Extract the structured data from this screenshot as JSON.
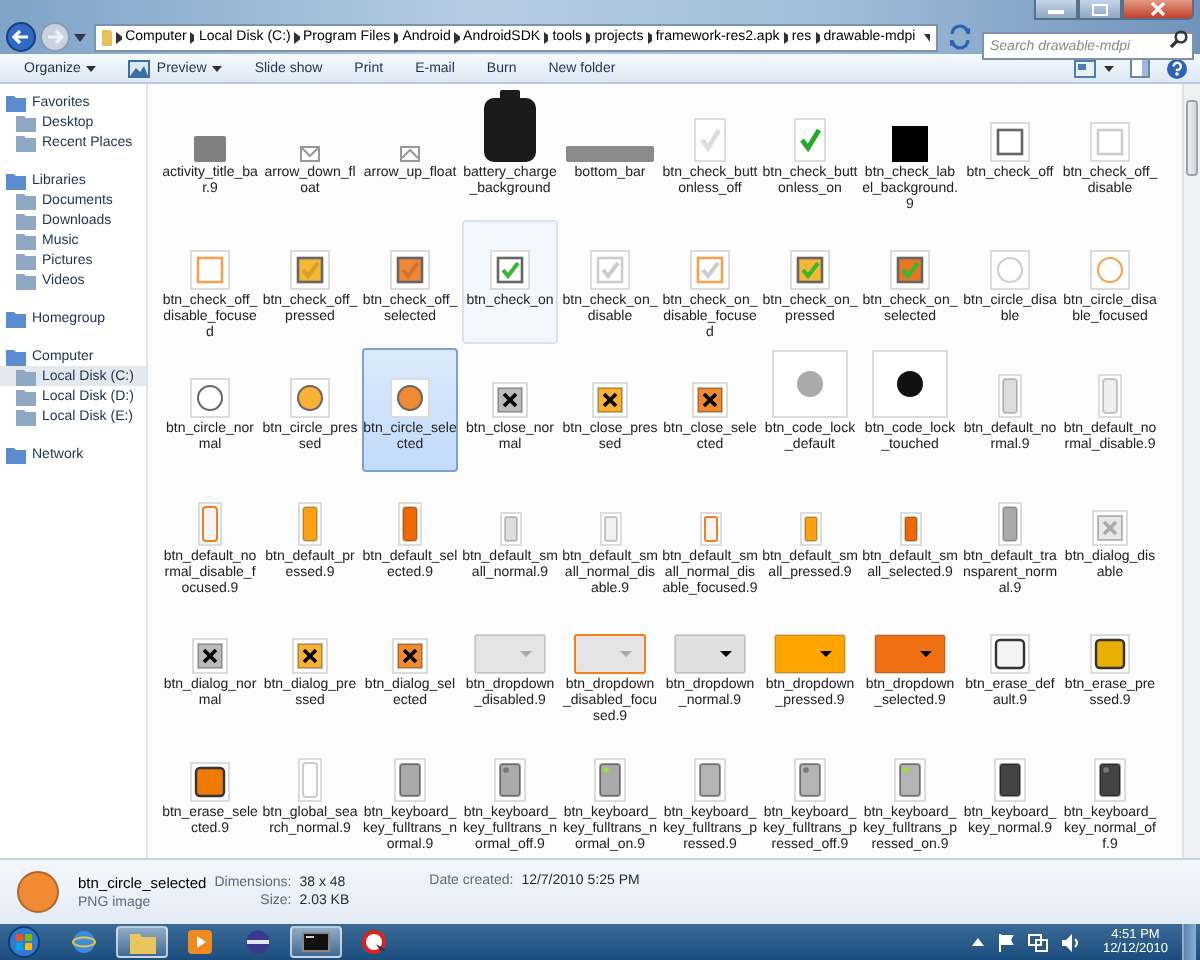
{
  "address": {
    "segments": [
      "Computer",
      "Local Disk (C:)",
      "Program Files",
      "Android",
      "AndroidSDK",
      "tools",
      "projects",
      "framework-res2.apk",
      "res",
      "drawable-mdpi"
    ]
  },
  "search": {
    "placeholder": "Search drawable-mdpi"
  },
  "toolbar": [
    {
      "label": "Organize",
      "dropdown": true
    },
    {
      "label": "Preview",
      "dropdown": true
    },
    {
      "label": "Slide show",
      "dropdown": false
    },
    {
      "label": "Print",
      "dropdown": false
    },
    {
      "label": "E-mail",
      "dropdown": false
    },
    {
      "label": "Burn",
      "dropdown": false
    },
    {
      "label": "New folder",
      "dropdown": false
    }
  ],
  "sidebar": [
    {
      "label": "Favorites",
      "selected": false,
      "children": [
        {
          "label": "Desktop",
          "selected": false
        },
        {
          "label": "Recent Places",
          "selected": false
        }
      ]
    },
    {
      "label": "Libraries",
      "selected": false,
      "children": [
        {
          "label": "Documents",
          "selected": false
        },
        {
          "label": "Downloads",
          "selected": false
        },
        {
          "label": "Music",
          "selected": false
        },
        {
          "label": "Pictures",
          "selected": false
        },
        {
          "label": "Videos",
          "selected": false
        }
      ]
    },
    {
      "label": "Homegroup",
      "selected": false
    },
    {
      "label": "Computer",
      "selected": false,
      "children": [
        {
          "label": "Local Disk (C:)",
          "selected": true
        },
        {
          "label": "Local Disk (D:)",
          "selected": false
        },
        {
          "label": "Local Disk (E:)",
          "selected": false
        }
      ]
    },
    {
      "label": "Network",
      "selected": false
    }
  ],
  "files": [
    {
      "name": "activity_title_bar.9",
      "selected": false,
      "hovered": false,
      "thumb": {
        "kind": "panel",
        "color": "#808080"
      }
    },
    {
      "name": "arrow_down_float",
      "selected": false,
      "hovered": false,
      "thumb": {
        "kind": "arrow-down",
        "color": "#999999"
      }
    },
    {
      "name": "arrow_up_float",
      "selected": false,
      "hovered": false,
      "thumb": {
        "kind": "arrow-up",
        "color": "#999999"
      }
    },
    {
      "name": "battery_charge_background",
      "selected": false,
      "hovered": false,
      "thumb": {
        "kind": "battery",
        "color": "#1a1a1a"
      }
    },
    {
      "name": "bottom_bar",
      "selected": false,
      "hovered": false,
      "thumb": {
        "kind": "strip",
        "color": "#8a8a8a"
      }
    },
    {
      "name": "btn_check_buttonless_off",
      "selected": false,
      "hovered": false,
      "thumb": {
        "kind": "tick",
        "checked": false
      }
    },
    {
      "name": "btn_check_buttonless_on",
      "selected": false,
      "hovered": false,
      "thumb": {
        "kind": "tick",
        "checked": true
      }
    },
    {
      "name": "btn_check_label_background.9",
      "selected": false,
      "hovered": false,
      "thumb": {
        "kind": "square",
        "color": "#000000"
      }
    },
    {
      "name": "btn_check_off",
      "selected": false,
      "hovered": false,
      "thumb": {
        "kind": "checkbox",
        "checked": false,
        "disabled": false,
        "focused": false
      }
    },
    {
      "name": "btn_check_off_disable",
      "selected": false,
      "hovered": false,
      "thumb": {
        "kind": "checkbox",
        "checked": false,
        "disabled": true,
        "focused": false
      }
    },
    {
      "name": "btn_check_off_disable_focused",
      "selected": false,
      "hovered": false,
      "thumb": {
        "kind": "checkbox",
        "checked": false,
        "disabled": true,
        "focused": true
      }
    },
    {
      "name": "btn_check_off_pressed",
      "selected": false,
      "hovered": false,
      "thumb": {
        "kind": "checkbox",
        "color": "#f7b733",
        "checked": false,
        "disabled": false,
        "focused": false
      }
    },
    {
      "name": "btn_check_off_selected",
      "selected": false,
      "hovered": false,
      "thumb": {
        "kind": "checkbox",
        "color": "#ee8833",
        "checked": false,
        "disabled": false,
        "focused": false
      }
    },
    {
      "name": "btn_check_on",
      "selected": false,
      "hovered": true,
      "thumb": {
        "kind": "checkbox",
        "checked": true,
        "disabled": false,
        "focused": false
      }
    },
    {
      "name": "btn_check_on_disable",
      "selected": false,
      "hovered": false,
      "thumb": {
        "kind": "checkbox",
        "checked": true,
        "disabled": true,
        "focused": false
      }
    },
    {
      "name": "btn_check_on_disable_focused",
      "selected": false,
      "hovered": false,
      "thumb": {
        "kind": "checkbox",
        "checked": true,
        "disabled": true,
        "focused": true
      }
    },
    {
      "name": "btn_check_on_pressed",
      "selected": false,
      "hovered": false,
      "thumb": {
        "kind": "checkbox",
        "color": "#f7b733",
        "checked": true,
        "disabled": false,
        "focused": false
      }
    },
    {
      "name": "btn_check_on_selected",
      "selected": false,
      "hovered": false,
      "thumb": {
        "kind": "checkbox",
        "color": "#e87722",
        "checked": true,
        "disabled": false,
        "focused": false
      }
    },
    {
      "name": "btn_circle_disable",
      "selected": false,
      "hovered": false,
      "thumb": {
        "kind": "circle",
        "disabled": true,
        "focused": false
      }
    },
    {
      "name": "btn_circle_disable_focused",
      "selected": false,
      "hovered": false,
      "thumb": {
        "kind": "circle",
        "disabled": true,
        "focused": true
      }
    },
    {
      "name": "btn_circle_normal",
      "selected": false,
      "hovered": false,
      "thumb": {
        "kind": "circle",
        "disabled": false,
        "focused": false
      }
    },
    {
      "name": "btn_circle_pressed",
      "selected": false,
      "hovered": false,
      "thumb": {
        "kind": "circle",
        "color": "#f9b233",
        "disabled": false,
        "focused": false
      }
    },
    {
      "name": "btn_circle_selected",
      "selected": true,
      "hovered": false,
      "thumb": {
        "kind": "circle",
        "color": "#f08a33",
        "disabled": false,
        "focused": false
      }
    },
    {
      "name": "btn_close_normal",
      "selected": false,
      "hovered": false,
      "thumb": {
        "kind": "close",
        "color": "#bbbbbb",
        "disabled": false
      }
    },
    {
      "name": "btn_close_pressed",
      "selected": false,
      "hovered": false,
      "thumb": {
        "kind": "close",
        "color": "#f9b233",
        "disabled": false
      }
    },
    {
      "name": "btn_close_selected",
      "selected": false,
      "hovered": false,
      "thumb": {
        "kind": "close",
        "color": "#ef8a2e",
        "disabled": false
      }
    },
    {
      "name": "btn_code_lock_default",
      "selected": false,
      "hovered": false,
      "thumb": {
        "kind": "lock",
        "color": "#aaaaaa"
      }
    },
    {
      "name": "btn_code_lock_touched",
      "selected": false,
      "hovered": false,
      "thumb": {
        "kind": "lock",
        "color": "#111111"
      }
    },
    {
      "name": "btn_default_normal.9",
      "selected": false,
      "hovered": false,
      "thumb": {
        "kind": "tall",
        "color": "#dddddd",
        "focused": false
      }
    },
    {
      "name": "btn_default_normal_disable.9",
      "selected": false,
      "hovered": false,
      "thumb": {
        "kind": "tall",
        "color": "#eeeeee",
        "focused": false
      }
    },
    {
      "name": "btn_default_normal_disable_focused.9",
      "selected": false,
      "hovered": false,
      "thumb": {
        "kind": "tall",
        "color": "#f4f4f4",
        "focused": true
      }
    },
    {
      "name": "btn_default_pressed.9",
      "selected": false,
      "hovered": false,
      "thumb": {
        "kind": "tall",
        "color": "#ffa010",
        "focused": false
      }
    },
    {
      "name": "btn_default_selected.9",
      "selected": false,
      "hovered": false,
      "thumb": {
        "kind": "tall",
        "color": "#ee6a00",
        "focused": false
      }
    },
    {
      "name": "btn_default_small_normal.9",
      "selected": false,
      "hovered": false,
      "thumb": {
        "kind": "small",
        "color": "#dddddd",
        "focused": false
      }
    },
    {
      "name": "btn_default_small_normal_disable.9",
      "selected": false,
      "hovered": false,
      "thumb": {
        "kind": "small",
        "color": "#f0f0f0",
        "focused": false
      }
    },
    {
      "name": "btn_default_small_normal_disable_focused.9",
      "selected": false,
      "hovered": false,
      "thumb": {
        "kind": "small",
        "color": "#f4f4f4",
        "focused": true
      }
    },
    {
      "name": "btn_default_small_pressed.9",
      "selected": false,
      "hovered": false,
      "thumb": {
        "kind": "small",
        "color": "#ffa010",
        "focused": false
      }
    },
    {
      "name": "btn_default_small_selected.9",
      "selected": false,
      "hovered": false,
      "thumb": {
        "kind": "small",
        "color": "#ee6a00",
        "focused": false
      }
    },
    {
      "name": "btn_default_transparent_normal.9",
      "selected": false,
      "hovered": false,
      "thumb": {
        "kind": "tall",
        "color": "#aaaaaa",
        "focused": false
      }
    },
    {
      "name": "btn_dialog_disable",
      "selected": false,
      "hovered": false,
      "thumb": {
        "kind": "close",
        "color": "#e8e8e8",
        "disabled": true
      }
    },
    {
      "name": "btn_dialog_normal",
      "selected": false,
      "hovered": false,
      "thumb": {
        "kind": "close",
        "color": "#bbbbbb",
        "disabled": false
      }
    },
    {
      "name": "btn_dialog_pressed",
      "selected": false,
      "hovered": false,
      "thumb": {
        "kind": "close",
        "color": "#f9b233",
        "disabled": false
      }
    },
    {
      "name": "btn_dialog_selected",
      "selected": false,
      "hovered": false,
      "thumb": {
        "kind": "close",
        "color": "#ef8a2e",
        "disabled": false
      }
    },
    {
      "name": "btn_dropdown_disabled.9",
      "selected": false,
      "hovered": false,
      "thumb": {
        "kind": "dropdown",
        "color": "#e4e4e4",
        "disabled": true,
        "focused": false
      }
    },
    {
      "name": "btn_dropdown_disabled_focused.9",
      "selected": false,
      "hovered": false,
      "thumb": {
        "kind": "dropdown",
        "color": "#e4e4e4",
        "disabled": true,
        "focused": true
      }
    },
    {
      "name": "btn_dropdown_normal.9",
      "selected": false,
      "hovered": false,
      "thumb": {
        "kind": "dropdown",
        "color": "#e0e0e0",
        "disabled": false,
        "focused": false
      }
    },
    {
      "name": "btn_dropdown_pressed.9",
      "selected": false,
      "hovered": false,
      "thumb": {
        "kind": "dropdown",
        "color": "#ffa500",
        "disabled": false,
        "focused": false
      }
    },
    {
      "name": "btn_dropdown_selected.9",
      "selected": false,
      "hovered": false,
      "thumb": {
        "kind": "dropdown",
        "color": "#ee7010",
        "disabled": false,
        "focused": false
      }
    },
    {
      "name": "btn_erase_default.9",
      "selected": false,
      "hovered": false,
      "thumb": {
        "kind": "erase",
        "color": "#f4f4f4"
      }
    },
    {
      "name": "btn_erase_pressed.9",
      "selected": false,
      "hovered": false,
      "thumb": {
        "kind": "erase",
        "color": "#e8b000"
      }
    },
    {
      "name": "btn_erase_selected.9",
      "selected": false,
      "hovered": false,
      "thumb": {
        "kind": "erase",
        "color": "#ee7a00"
      }
    },
    {
      "name": "btn_global_search_normal.9",
      "selected": false,
      "hovered": false,
      "thumb": {
        "kind": "tall",
        "focused": false
      }
    },
    {
      "name": "btn_keyboard_key_fulltrans_normal.9",
      "selected": false,
      "hovered": false,
      "thumb": {
        "kind": "key",
        "color": "#aaaaaa"
      }
    },
    {
      "name": "btn_keyboard_key_fulltrans_normal_off.9",
      "selected": false,
      "hovered": false,
      "thumb": {
        "kind": "key-led",
        "color": "#aaaaaa",
        "lit": false
      }
    },
    {
      "name": "btn_keyboard_key_fulltrans_normal_on.9",
      "selected": false,
      "hovered": false,
      "thumb": {
        "kind": "key-led",
        "color": "#aaaaaa",
        "lit": true
      }
    },
    {
      "name": "btn_keyboard_key_fulltrans_pressed.9",
      "selected": false,
      "hovered": false,
      "thumb": {
        "kind": "key",
        "color": "#b4b4b4"
      }
    },
    {
      "name": "btn_keyboard_key_fulltrans_pressed_off.9",
      "selected": false,
      "hovered": false,
      "thumb": {
        "kind": "key-led",
        "color": "#b4b4b4",
        "lit": false
      }
    },
    {
      "name": "btn_keyboard_key_fulltrans_pressed_on.9",
      "selected": false,
      "hovered": false,
      "thumb": {
        "kind": "key-led",
        "color": "#b4b4b4",
        "lit": true
      }
    },
    {
      "name": "btn_keyboard_key_normal.9",
      "selected": false,
      "hovered": false,
      "thumb": {
        "kind": "key",
        "color": "#444444"
      }
    },
    {
      "name": "btn_keyboard_key_normal_off.9",
      "selected": false,
      "hovered": false,
      "thumb": {
        "kind": "key-led",
        "color": "#444444",
        "lit": false
      }
    }
  ],
  "details": {
    "name": "btn_circle_selected",
    "type": "PNG image",
    "fields": [
      {
        "label": "Dimensions:",
        "value": "38 x 48"
      },
      {
        "label": "Size:",
        "value": "2.03 KB"
      },
      {
        "label": "Date created:",
        "value": "12/7/2010 5:25 PM"
      }
    ]
  },
  "taskbar": {
    "apps": [
      {
        "active": false
      },
      {
        "active": true
      },
      {
        "active": false
      },
      {
        "active": false
      },
      {
        "active": true
      },
      {
        "active": false
      }
    ],
    "time": "4:51 PM",
    "date": "12/12/2010"
  }
}
